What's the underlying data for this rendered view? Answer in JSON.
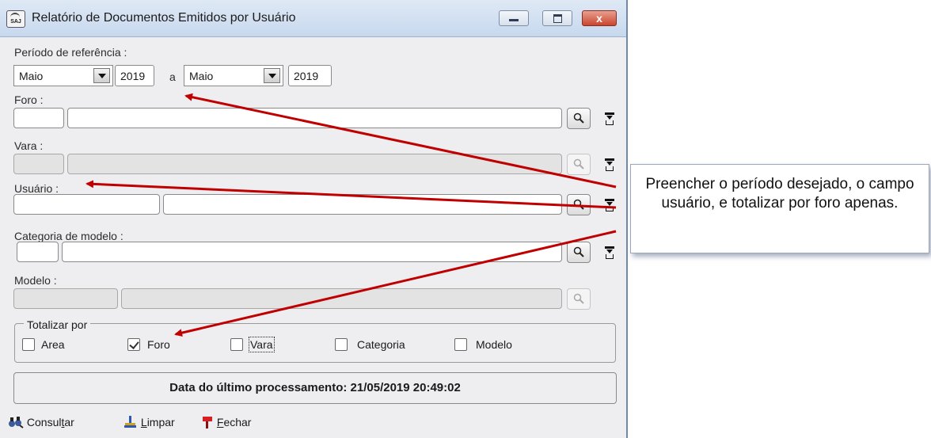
{
  "window": {
    "title": "Relatório de Documentos Emitidos por Usuário",
    "app_icon_text": "SAJ",
    "close_symbol": "x"
  },
  "periodo": {
    "label": "Período de referência :",
    "from_month": "Maio",
    "from_year": "2019",
    "separator": "a",
    "to_month": "Maio",
    "to_year": "2019"
  },
  "foro": {
    "label": "Foro :",
    "code": "",
    "name": ""
  },
  "vara": {
    "label": "Vara :",
    "code": "",
    "name": ""
  },
  "usuario": {
    "label": "Usuário :",
    "code": "",
    "name": ""
  },
  "categoria": {
    "label": "Categoria de modelo :",
    "code": "",
    "name": ""
  },
  "modelo": {
    "label": "Modelo :",
    "code": "",
    "name": ""
  },
  "totalizar": {
    "title": "Totalizar por",
    "options": [
      {
        "label": "Area",
        "checked": false
      },
      {
        "label": "Foro",
        "checked": true
      },
      {
        "label": "Vara",
        "checked": false
      },
      {
        "label": "Categoria",
        "checked": false
      },
      {
        "label": "Modelo",
        "checked": false
      }
    ]
  },
  "status": {
    "text": "Data do último processamento: 21/05/2019 20:49:02"
  },
  "toolbar": {
    "consultar_pre": "Consul",
    "consultar_u": "t",
    "consultar_post": "ar",
    "limpar_u": "L",
    "limpar_post": "impar",
    "fechar_u": "F",
    "fechar_post": "echar"
  },
  "annotation": {
    "text": "Preencher o período desejado, o campo usuário, e totalizar por foro apenas.",
    "arrow_color": "#c00000"
  },
  "colors": {
    "window_bg": "#eeedf0",
    "titlebar": "#c7d8ee",
    "close_button": "#c9452f",
    "arrow": "#c00000"
  }
}
